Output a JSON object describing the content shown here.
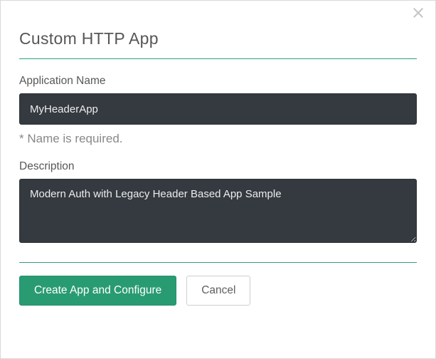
{
  "modal": {
    "title": "Custom HTTP App",
    "fields": {
      "app_name": {
        "label": "Application Name",
        "value": "MyHeaderApp",
        "hint": "* Name is required."
      },
      "description": {
        "label": "Description",
        "value": "Modern Auth with Legacy Header Based App Sample"
      }
    },
    "buttons": {
      "primary": "Create App and Configure",
      "cancel": "Cancel"
    }
  }
}
